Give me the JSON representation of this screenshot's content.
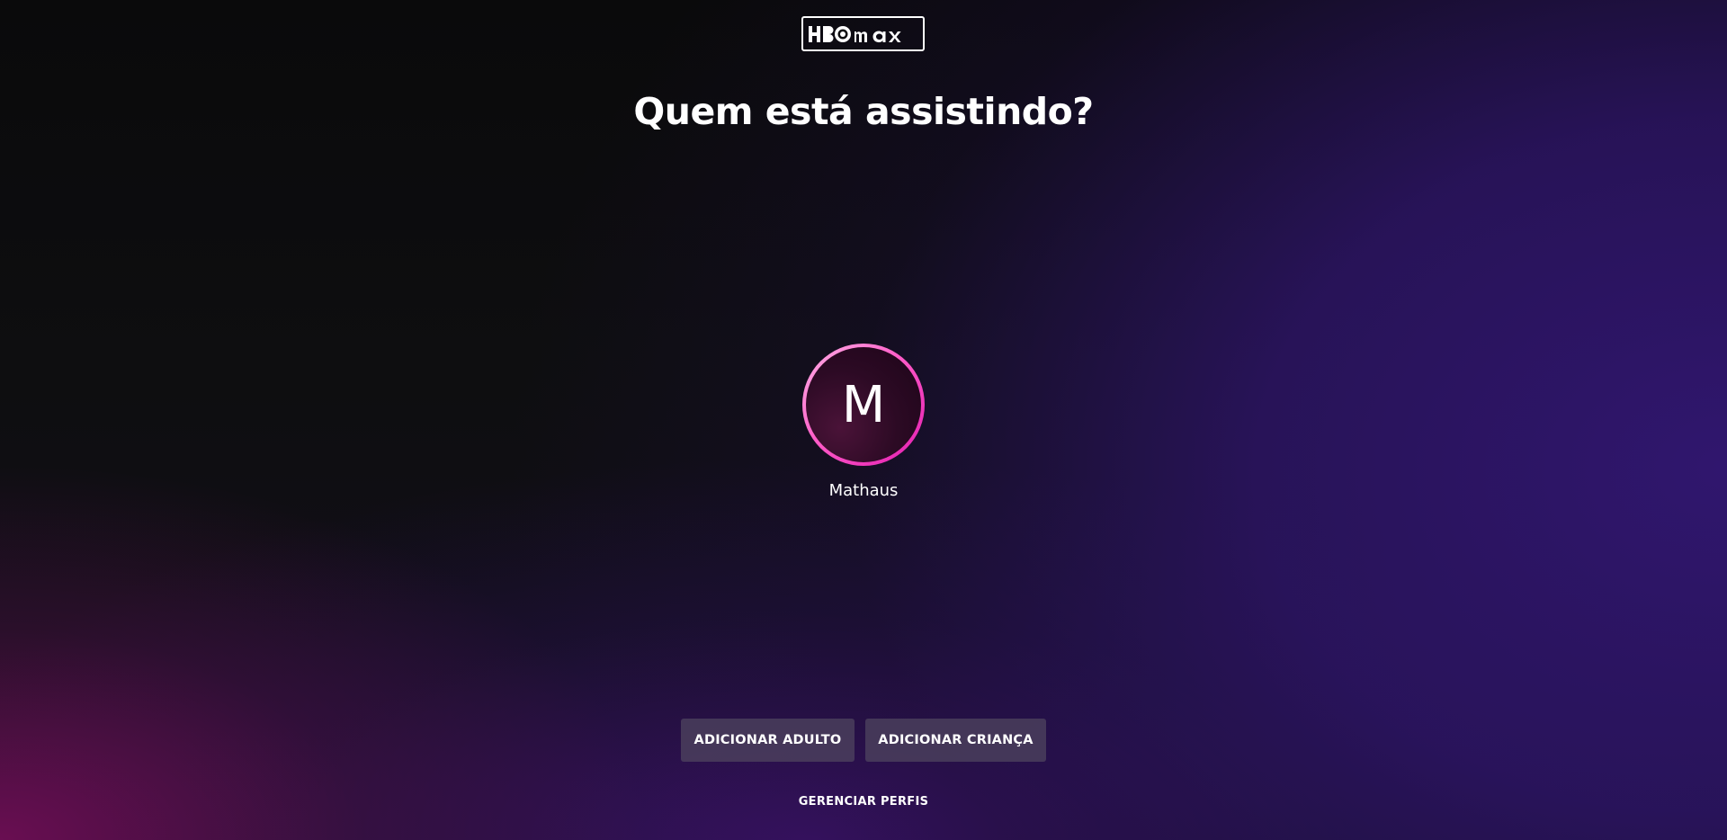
{
  "brand": {
    "logo_text": "HBOmax",
    "accent_color": "#ff2fbf"
  },
  "heading": "Quem está assistindo?",
  "profiles": [
    {
      "initial": "M",
      "name": "Mathaus"
    }
  ],
  "actions": {
    "add_adult_label": "ADICIONAR ADULTO",
    "add_child_label": "ADICIONAR CRIANÇA",
    "manage_profiles_label": "GERENCIAR PERFIS"
  }
}
